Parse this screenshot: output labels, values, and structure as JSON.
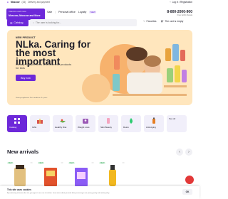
{
  "topbar": {
    "city": "Moscow",
    "city_suffix": "(24)",
    "links": [
      "Delivery and payment"
    ],
    "login": "Log in / Registration"
  },
  "header": {
    "logo_line1": "Vitamins and more",
    "logo_line2": "Moscow, Moscow and More",
    "nav": [
      "Sale",
      "Personal office",
      "Loyalty"
    ],
    "nav_badge": "NEW",
    "phone": "8-800-2000-900",
    "phone_sub": "Free within Russia"
  },
  "searchbar": {
    "catalog": "Catalog",
    "placeholder": "The user is looking for...",
    "favorites": "Favorites",
    "cart": "The cart is empty"
  },
  "hero": {
    "tag": "NEW PRODUCT",
    "title": "NLka. Caring for the most important",
    "desc": "Dietary Supplements and cosmetic products for kids",
    "button": "Buy now",
    "note": "Dietary supplement. Not a medicine. 0+ years"
  },
  "categories": [
    {
      "label": "Catalog",
      "active": true
    },
    {
      "label": "Gifts",
      "active": false
    },
    {
      "label": "Healthy Diet",
      "active": false
    },
    {
      "label": "Weight Loss",
      "active": false
    },
    {
      "label": "Skin Beauty",
      "active": false
    },
    {
      "label": "Detox",
      "active": false
    },
    {
      "label": "Anti-Aging",
      "active": false
    },
    {
      "label": "See all",
      "active": false
    }
  ],
  "arrivals": {
    "title": "New arrivals",
    "prev": "‹",
    "next": "›",
    "items": [
      {
        "badge": "NEW",
        "color": "#e2c07f"
      },
      {
        "badge": "NEW",
        "color": "#e2522c"
      },
      {
        "badge": "NEW",
        "color": "#8b5cf6"
      },
      {
        "badge": "NEW",
        "color": "#f2b81f"
      }
    ]
  },
  "cookie": {
    "title": "This site uses cookies",
    "text": "By continuing to browse the site, you agree to our use of cookies. Learn more about personal data processing in our privacy policy and cookie policy.",
    "ok": "OK"
  },
  "colors": {
    "accent": "#6d28d9",
    "hero_bg": "#ffe6bd",
    "tile_bg": "#f1effa"
  }
}
